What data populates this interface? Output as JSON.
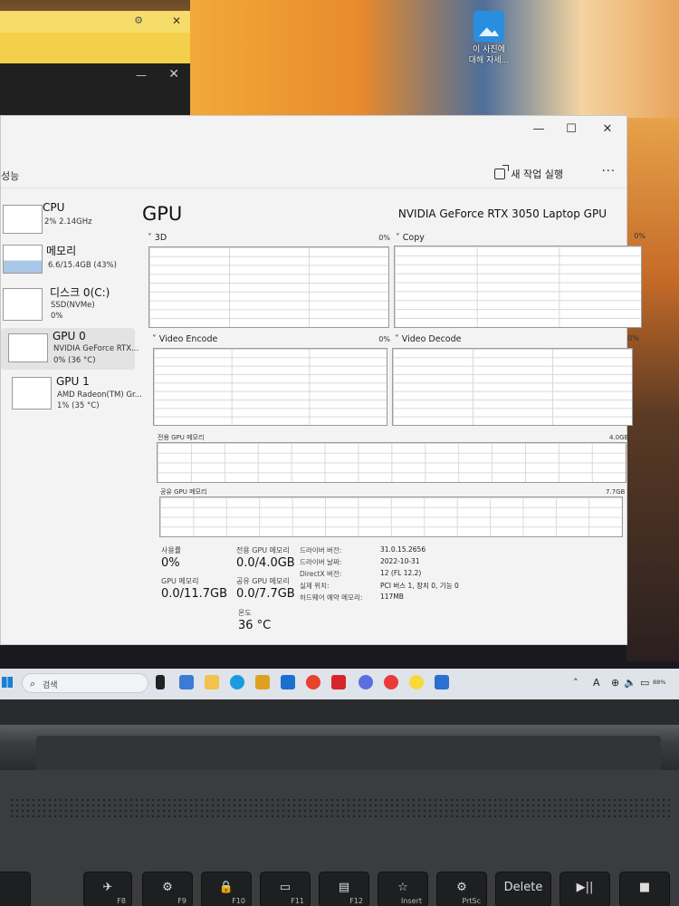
{
  "desktop": {
    "icon_label_line1": "이 사진에",
    "icon_label_line2": "대해 자세..."
  },
  "bg_window": {
    "minimize": "—",
    "close": "✕"
  },
  "window": {
    "minimize": "—",
    "maximize": "☐",
    "close": "✕",
    "section_title": "성능",
    "run_task_label": "새 작업 실행",
    "more_label": "···"
  },
  "sidebar": {
    "items": [
      {
        "name": "CPU",
        "sub1": "2% 2.14GHz",
        "sub2": ""
      },
      {
        "name": "메모리",
        "sub1": "6.6/15.4GB (43%)",
        "sub2": ""
      },
      {
        "name": "디스크 0(C:)",
        "sub1": "SSD(NVMe)",
        "sub2": "0%"
      },
      {
        "name": "GPU 0",
        "sub1": "NVIDIA GeForce RTX...",
        "sub2": "0% (36 °C)"
      },
      {
        "name": "GPU 1",
        "sub1": "AMD Radeon(TM) Gr...",
        "sub2": "1% (35 °C)"
      }
    ]
  },
  "main": {
    "title": "GPU",
    "model": "NVIDIA GeForce RTX 3050 Laptop GPU",
    "graphs": [
      {
        "label": "3D",
        "value": "0%"
      },
      {
        "label": "Copy",
        "value": "0%"
      },
      {
        "label": "Video Encode",
        "value": "0%"
      },
      {
        "label": "Video Decode",
        "value": "0%"
      }
    ],
    "dedicated_label": "전용 GPU 메모리",
    "dedicated_max": "4.0GB",
    "shared_label": "공유 GPU 메모리",
    "shared_max": "7.7GB"
  },
  "stats": {
    "usage_label": "사용률",
    "usage_value": "0%",
    "gpu_mem_label": "GPU 메모리",
    "gpu_mem_value": "0.0/11.7GB",
    "dedicated_label": "전용 GPU 메모리",
    "dedicated_value": "0.0/4.0GB",
    "shared_label": "공유 GPU 메모리",
    "shared_value": "0.0/7.7GB",
    "temp_label": "온도",
    "temp_value": "36 °C"
  },
  "info": [
    {
      "key": "드라이버 버전:",
      "value": "31.0.15.2656"
    },
    {
      "key": "드라이버 날짜:",
      "value": "2022-10-31"
    },
    {
      "key": "DirectX 버전:",
      "value": "12 (FL 12.2)"
    },
    {
      "key": "실제 위치:",
      "value": "PCI 버스 1, 장치 0, 기능 0"
    },
    {
      "key": "하드웨어 예약 메모리:",
      "value": "117MB"
    }
  ],
  "taskbar": {
    "search_placeholder": "검색",
    "tray_lang": "A",
    "tray_battery": "88%"
  },
  "keyboard": {
    "keys": [
      {
        "main": "",
        "fn": ""
      },
      {
        "main": "✈",
        "fn": "F8"
      },
      {
        "main": "⚙",
        "fn": "F9"
      },
      {
        "main": "🔒",
        "fn": "F10"
      },
      {
        "main": "▭",
        "fn": "F11"
      },
      {
        "main": "▤",
        "fn": "F12"
      },
      {
        "main": "☆",
        "fn": "Insert"
      },
      {
        "main": "⚙",
        "fn": "PrtSc"
      },
      {
        "main": "Delete",
        "fn": ""
      },
      {
        "main": "▶||",
        "fn": ""
      },
      {
        "main": "■",
        "fn": ""
      }
    ]
  }
}
